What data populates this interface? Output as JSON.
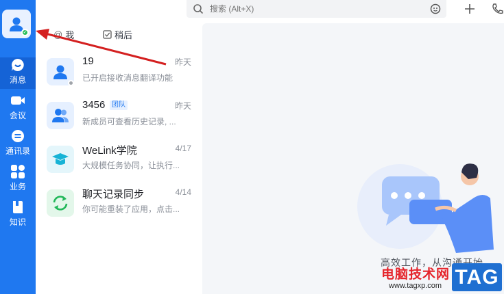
{
  "sidebar": {
    "nav": [
      {
        "label": "消息"
      },
      {
        "label": "会议"
      },
      {
        "label": "通讯录"
      },
      {
        "label": "业务"
      },
      {
        "label": "知识"
      }
    ]
  },
  "search": {
    "placeholder": "搜索 (Alt+X)"
  },
  "tabs": [
    {
      "label": "我"
    },
    {
      "label": "稍后"
    }
  ],
  "conversations": [
    {
      "title": "19",
      "time": "昨天",
      "preview": "已开启接收消息翻译功能"
    },
    {
      "title": "3456",
      "badge": "团队",
      "time": "昨天",
      "preview": "新成员可查看历史记录, ..."
    },
    {
      "title": "WeLink学院",
      "time": "4/17",
      "preview": "大规模任务协同，让执行..."
    },
    {
      "title": "聊天记录同步",
      "time": "4/14",
      "preview": "你可能重装了应用，点击..."
    }
  ],
  "empty_state": {
    "slogan": "高效工作，从沟通开始"
  },
  "watermark": {
    "site_name": "电脑技术网",
    "url": "www.tagxp.com",
    "tag": "TAG"
  },
  "colors": {
    "brand": "#1f78f0",
    "active_nav": "#1563d6",
    "annotation_arrow": "#d42020"
  },
  "icons": {
    "nav": [
      "message-icon",
      "meeting-icon",
      "contacts-icon",
      "apps-icon",
      "knowledge-icon"
    ],
    "top": [
      "search-icon",
      "gesture-icon",
      "plus-icon",
      "phone-icon"
    ]
  }
}
